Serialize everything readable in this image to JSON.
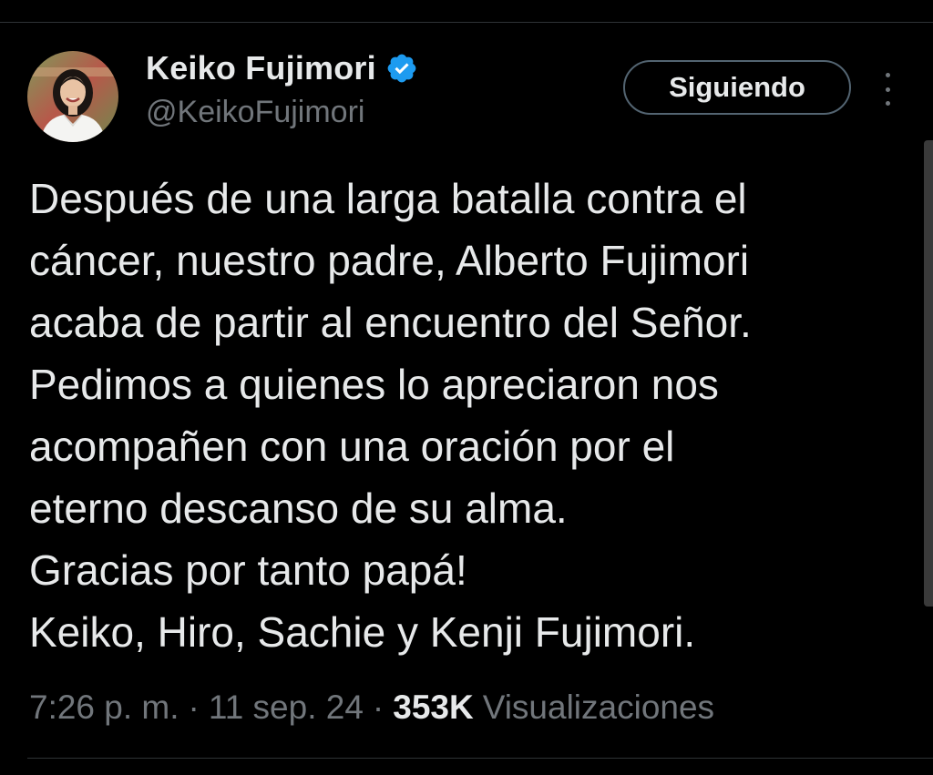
{
  "author": {
    "display_name": "Keiko Fujimori",
    "handle": "@KeikoFujimori",
    "verified_icon": "verified-badge-icon",
    "avatar_icon": "profile-photo"
  },
  "follow_button": {
    "label": "Siguiendo"
  },
  "more_icon": "more-options-icon",
  "tweet": {
    "lines": [
      "Después de una larga batalla contra el",
      "cáncer, nuestro padre, Alberto Fujimori",
      "acaba de partir al encuentro del Señor.",
      "Pedimos a quienes lo apreciaron nos",
      "acompañen con una oración por el",
      "eterno descanso de su alma.",
      "Gracias por tanto papá!",
      "Keiko, Hiro, Sachie y Kenji Fujimori."
    ]
  },
  "meta": {
    "time": "7:26 p. m.",
    "separator": "·",
    "date": "11 sep. 24",
    "views_count": "353K",
    "views_label": "Visualizaciones"
  },
  "colors": {
    "background": "#000000",
    "primary_text": "#e7e9ea",
    "secondary_text": "#71767b",
    "verified_blue": "#1d9bf0",
    "divider": "#2f3336"
  }
}
